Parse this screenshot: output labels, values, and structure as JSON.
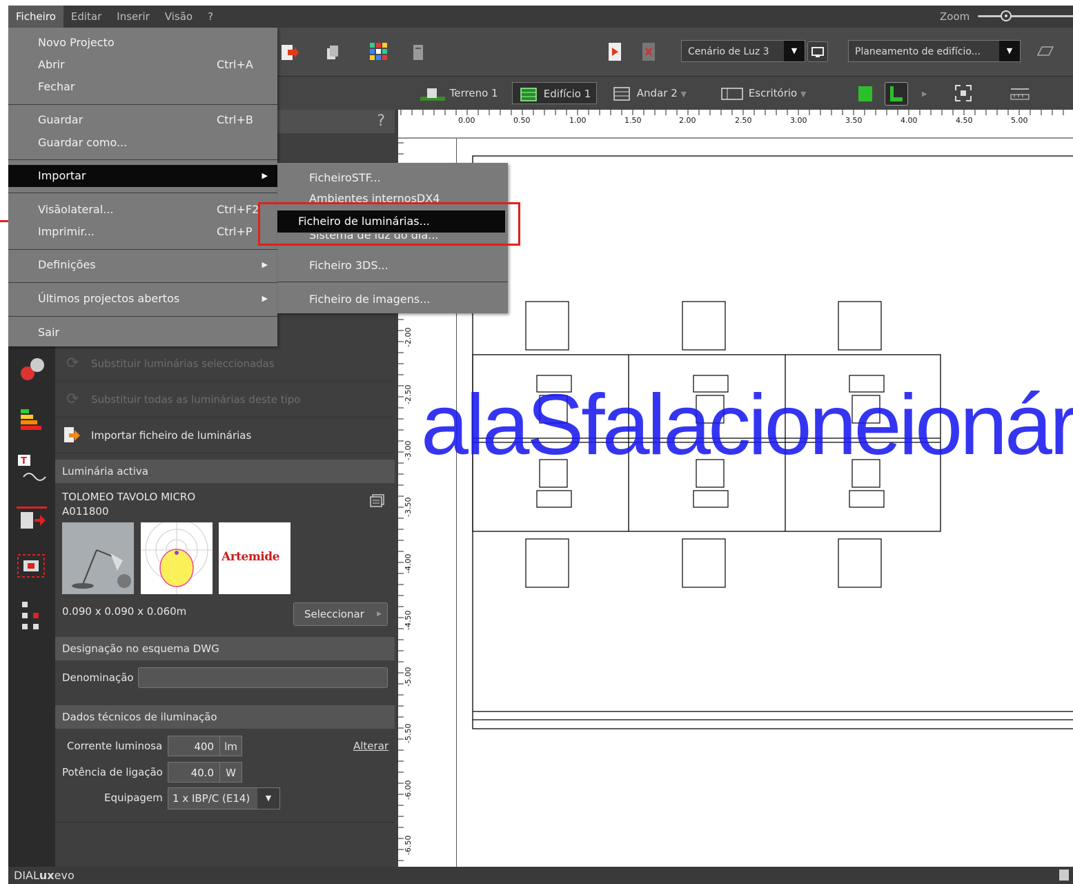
{
  "menubar": {
    "items": [
      "Ficheiro",
      "Editar",
      "Inserir",
      "Visão",
      "?"
    ],
    "zoom_label": "Zoom"
  },
  "toolbar": {
    "scenario": "Cenário de Luz 3",
    "planning": "Planeamento de edifício...",
    "nav": [
      "Terreno 1",
      "Edifício 1",
      "Andar 2",
      "Escritório"
    ]
  },
  "ruler": {
    "top": [
      "0.00",
      "0.50",
      "1.00",
      "1.50",
      "2.00",
      "2.50",
      "3.00",
      "3.50",
      "4.00",
      "4.50",
      "5.00"
    ],
    "left": [
      "-2.00",
      "-2.50",
      "-3.00",
      "-3.50",
      "-4.00",
      "-4.50",
      "-5.00",
      "-5.50",
      "-6.00",
      "-6.50"
    ]
  },
  "file_menu": {
    "items": [
      {
        "label": "Novo Projecto",
        "shortcut": ""
      },
      {
        "label": "Abrir",
        "shortcut": "Ctrl+A"
      },
      {
        "label": "Fechar",
        "shortcut": ""
      },
      {
        "label": "Guardar",
        "shortcut": "Ctrl+B"
      },
      {
        "label": "Guardar como...",
        "shortcut": ""
      },
      {
        "label": "Importar",
        "shortcut": ""
      },
      {
        "label": "Visãolateral...",
        "shortcut": "Ctrl+F2"
      },
      {
        "label": "Imprimir...",
        "shortcut": "Ctrl+P"
      },
      {
        "label": "Definições",
        "shortcut": ""
      },
      {
        "label": "Últimos projectos abertos",
        "shortcut": ""
      },
      {
        "label": "Sair",
        "shortcut": ""
      }
    ]
  },
  "import_submenu": {
    "items": [
      "FicheiroSTF...",
      "Ambientes internosDX4",
      "Ficheiro de luminárias...",
      "Sistema de luz do dia...",
      "Ficheiro 3DS...",
      "Ficheiro de imagens..."
    ]
  },
  "panel": {
    "help": "?",
    "actions": [
      "Substituir luminárias seleccionadas",
      "Substituir todas as luminárias deste tipo",
      "Importar ficheiro de luminárias"
    ],
    "active_title": "Luminária activa",
    "lum_name": "TOLOMEO TAVOLO MICRO",
    "lum_code": "A011800",
    "brand": "Artemide",
    "dims": "0.090 x 0.090 x 0.060m",
    "select_btn": "Seleccionar",
    "dwg_title": "Designação no esquema DWG",
    "denom_label": "Denominação",
    "denom_value": "",
    "tech_title": "Dados técnicos de iluminação",
    "flux_label": "Corrente luminosa",
    "flux_value": "400",
    "flux_unit": "lm",
    "change_link": "Alterar",
    "power_label": "Potência de ligação",
    "power_value": "40.0",
    "power_unit": "W",
    "equip_label": "Equipagem",
    "equip_value": "1 x IBP/C (E14)"
  },
  "overlay": "alaSfalacioneionár",
  "status": {
    "prefix": "DIAL",
    "bold": "ux",
    "suffix": "evo"
  }
}
